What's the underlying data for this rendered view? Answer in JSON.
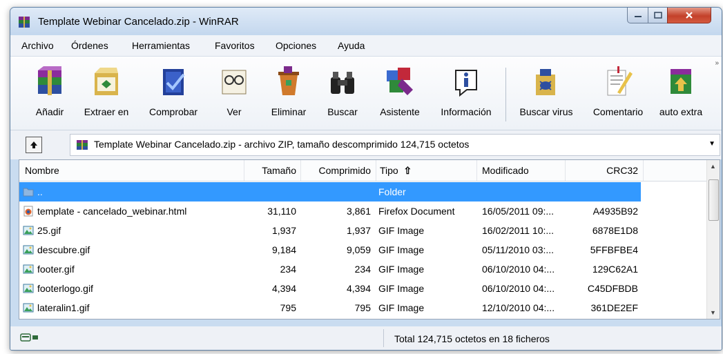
{
  "window": {
    "title": "Template Webinar Cancelado.zip - WinRAR"
  },
  "menu": [
    "Archivo",
    "Órdenes",
    "Herramientas",
    "Favoritos",
    "Opciones",
    "Ayuda"
  ],
  "toolbar": [
    {
      "label": "Añadir",
      "icon": "add-archive-icon"
    },
    {
      "label": "Extraer en",
      "icon": "extract-icon"
    },
    {
      "label": "Comprobar",
      "icon": "test-icon"
    },
    {
      "label": "Ver",
      "icon": "view-icon"
    },
    {
      "label": "Eliminar",
      "icon": "delete-icon"
    },
    {
      "label": "Buscar",
      "icon": "find-icon"
    },
    {
      "label": "Asistente",
      "icon": "wizard-icon"
    },
    {
      "label": "Información",
      "icon": "info-icon"
    },
    {
      "label": "Buscar virus",
      "icon": "virus-scan-icon"
    },
    {
      "label": "Comentario",
      "icon": "comment-icon"
    },
    {
      "label": "auto extra",
      "icon": "sfx-icon"
    }
  ],
  "address": {
    "text": "Template Webinar Cancelado.zip - archivo ZIP, tamaño descomprimido 124,715 octetos"
  },
  "columns": [
    "Nombre",
    "Tamaño",
    "Comprimido",
    "Tipo",
    "Modificado",
    "CRC32"
  ],
  "sort_indicator": "⇧",
  "rows": [
    {
      "name": "..",
      "size": "",
      "packed": "",
      "type": "Folder",
      "modified": "",
      "crc": "",
      "selected": true,
      "icon": "folder-icon"
    },
    {
      "name": "template - cancelado_webinar.html",
      "size": "31,110",
      "packed": "3,861",
      "type": "Firefox Document",
      "modified": "16/05/2011 09:...",
      "crc": "A4935B92",
      "icon": "firefox-html-icon"
    },
    {
      "name": "25.gif",
      "size": "1,937",
      "packed": "1,937",
      "type": "GIF Image",
      "modified": "16/02/2011 10:...",
      "crc": "6878E1D8",
      "icon": "gif-image-icon"
    },
    {
      "name": "descubre.gif",
      "size": "9,184",
      "packed": "9,059",
      "type": "GIF Image",
      "modified": "05/11/2010 03:...",
      "crc": "5FFBFBE4",
      "icon": "gif-image-icon"
    },
    {
      "name": "footer.gif",
      "size": "234",
      "packed": "234",
      "type": "GIF Image",
      "modified": "06/10/2010 04:...",
      "crc": "129C62A1",
      "icon": "gif-image-icon"
    },
    {
      "name": "footerlogo.gif",
      "size": "4,394",
      "packed": "4,394",
      "type": "GIF Image",
      "modified": "06/10/2010 04:...",
      "crc": "C45DFBDB",
      "icon": "gif-image-icon"
    },
    {
      "name": "lateralin1.gif",
      "size": "795",
      "packed": "795",
      "type": "GIF Image",
      "modified": "12/10/2010 04:...",
      "crc": "361DE2EF",
      "icon": "gif-image-icon"
    }
  ],
  "status": {
    "text": "Total 124,715 octetos en 18 ficheros"
  },
  "colors": {
    "selection": "#3399ff",
    "frame": "#c9dcf0",
    "close": "#c3412a"
  }
}
